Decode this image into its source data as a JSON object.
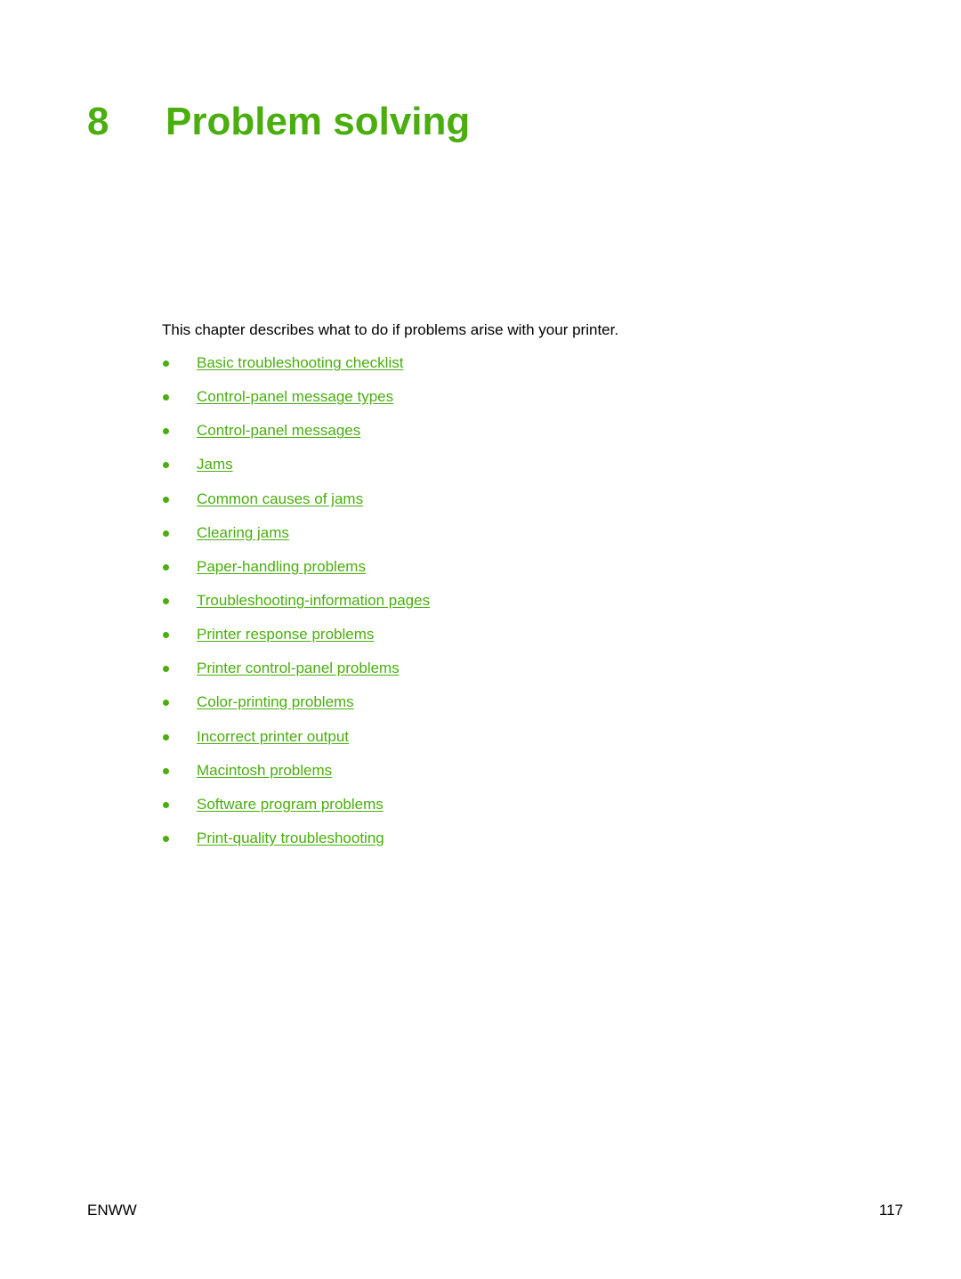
{
  "chapter": {
    "number": "8",
    "title": "Problem solving",
    "accent_color": "#4aae0e"
  },
  "intro": "This chapter describes what to do if problems arise with your printer.",
  "toc": [
    {
      "label": "Basic troubleshooting checklist"
    },
    {
      "label": "Control-panel message types"
    },
    {
      "label": "Control-panel messages"
    },
    {
      "label": "Jams"
    },
    {
      "label": "Common causes of jams"
    },
    {
      "label": "Clearing jams"
    },
    {
      "label": "Paper-handling problems"
    },
    {
      "label": "Troubleshooting-information pages"
    },
    {
      "label": "Printer response problems"
    },
    {
      "label": "Printer control-panel problems"
    },
    {
      "label": "Color-printing problems"
    },
    {
      "label": "Incorrect printer output"
    },
    {
      "label": "Macintosh problems"
    },
    {
      "label": "Software program problems"
    },
    {
      "label": "Print-quality troubleshooting"
    }
  ],
  "footer": {
    "left": "ENWW",
    "page_number": "117"
  }
}
